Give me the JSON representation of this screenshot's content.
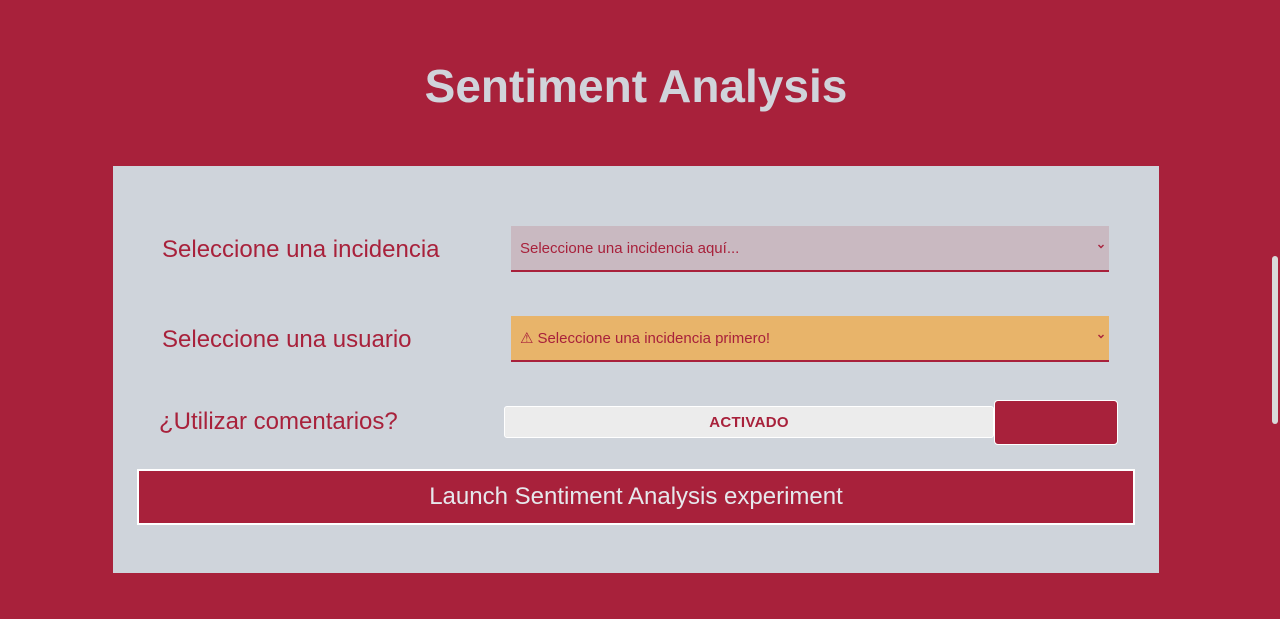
{
  "page": {
    "title": "Sentiment Analysis"
  },
  "form": {
    "incidencia_label": "Seleccione una incidencia",
    "incidencia_select": {
      "value": "Seleccione una incidencia aquí..."
    },
    "usuario_label": "Seleccione una usuario",
    "usuario_select": {
      "warning_icon": "⚠",
      "value": "Seleccione una incidencia primero!"
    },
    "comentarios_label": "¿Utilizar comentarios?",
    "comentarios_toggle": {
      "state_label": "ACTIVADO",
      "on": true
    },
    "launch_button": "Launch Sentiment Analysis experiment"
  },
  "colors": {
    "background": "#a8213b",
    "panel": "#cfd4db",
    "select_default": "#c9b9c1",
    "select_warning": "#e8b46a",
    "title_text": "#d0d4db"
  },
  "icons": {
    "select_chevron": "chevron-down-icon",
    "warning": "warning-icon"
  }
}
